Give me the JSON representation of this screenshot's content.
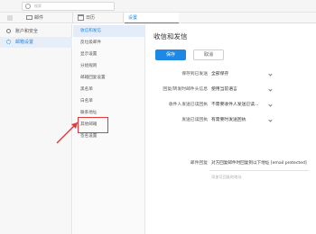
{
  "search": {
    "placeholder": "搜索"
  },
  "modules": {
    "mail": "邮件",
    "calendar": "日历",
    "settings": "设置"
  },
  "sidebar": {
    "items": [
      {
        "label": "账户和安全"
      },
      {
        "label": "邮箱设置"
      }
    ]
  },
  "settings_menu": {
    "items": [
      {
        "label": "收信和发信"
      },
      {
        "label": "反垃圾邮件"
      },
      {
        "label": "显示设置"
      },
      {
        "label": "分组规则"
      },
      {
        "label": "邮箱回复设置"
      },
      {
        "label": "黑名单"
      },
      {
        "label": "白名单"
      },
      {
        "label": "联系地址"
      },
      {
        "label": "其他邮箱"
      },
      {
        "label": "签名设置"
      }
    ]
  },
  "content": {
    "title": "收信和发信",
    "save": "保存",
    "cancel": "取消",
    "rows": [
      {
        "label": "保存到已发送",
        "value": "全部保存"
      },
      {
        "label": "回复/转发时邮件头信息",
        "value": "使用当前语言"
      },
      {
        "label": "收件人发送已读回执",
        "value": "不需要收件人发送已读..."
      },
      {
        "label": "发送已读回执",
        "value": "有需要时发送回执"
      },
      {
        "label": "邮件回复",
        "value": "对方回复邮件时回复到以下地址 [email protected]"
      }
    ],
    "sig_note": "添加可回复的地址"
  },
  "colors": {
    "accent": "#1e88e5",
    "highlight": "#e23a3a"
  }
}
